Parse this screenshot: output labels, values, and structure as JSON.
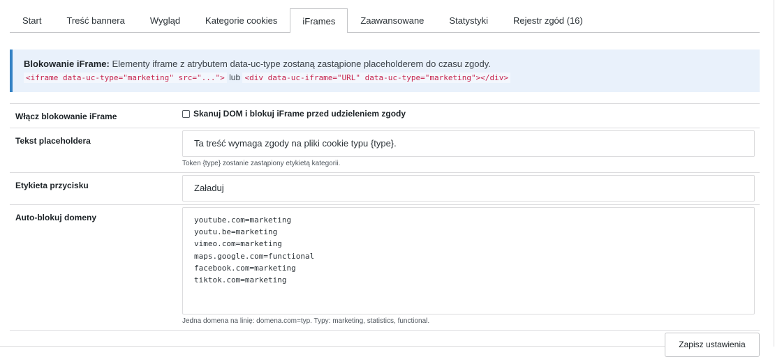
{
  "tabs": [
    {
      "label": "Start",
      "active": false
    },
    {
      "label": "Treść bannera",
      "active": false
    },
    {
      "label": "Wygląd",
      "active": false
    },
    {
      "label": "Kategorie cookies",
      "active": false
    },
    {
      "label": "iFrames",
      "active": true
    },
    {
      "label": "Zaawansowane",
      "active": false
    },
    {
      "label": "Statystyki",
      "active": false
    },
    {
      "label": "Rejestr zgód (16)",
      "active": false
    }
  ],
  "notice": {
    "title": "Blokowanie iFrame:",
    "text": "Elementy iframe z atrybutem data-uc-type zostaną zastąpione placeholderem do czasu zgody.",
    "code1": "<iframe data-uc-type=\"marketing\" src=\"...\">",
    "sep": "lub",
    "code2": "<div data-uc-iframe=\"URL\" data-uc-type=\"marketing\"></div>"
  },
  "fields": {
    "enable": {
      "label": "Włącz blokowanie iFrame",
      "checkbox_label": "Skanuj DOM i blokuj iFrame przed udzieleniem zgody",
      "checked": false
    },
    "placeholder_text": {
      "label": "Tekst placeholdera",
      "value": "Ta treść wymaga zgody na pliki cookie typu {type}.",
      "hint": "Token {type} zostanie zastąpiony etykietą kategorii."
    },
    "button_label": {
      "label": "Etykieta przycisku",
      "value": "Załaduj"
    },
    "auto_block": {
      "label": "Auto-blokuj domeny",
      "lines": [
        "youtube.com=marketing",
        "youtu.be=marketing",
        "vimeo.com=marketing",
        "maps.google.com=functional",
        "facebook.com=marketing",
        "tiktok.com=marketing"
      ],
      "hint": "Jedna domena na linię: domena.com=typ. Typy: marketing, statistics, functional."
    }
  },
  "save_label": "Zapisz ustawienia"
}
